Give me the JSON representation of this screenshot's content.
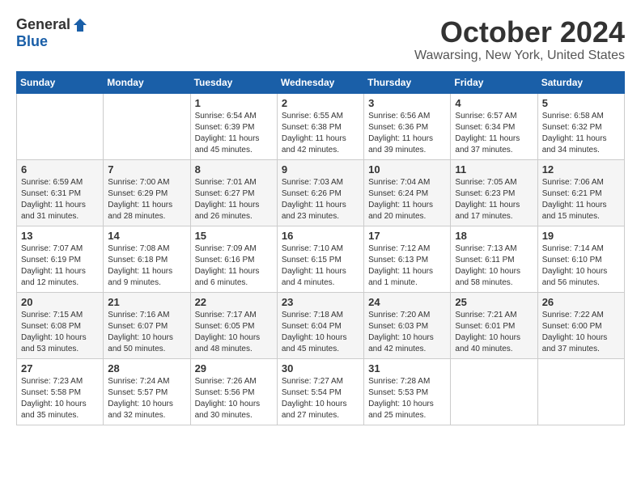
{
  "logo": {
    "general": "General",
    "blue": "Blue"
  },
  "title": "October 2024",
  "location": "Wawarsing, New York, United States",
  "days_of_week": [
    "Sunday",
    "Monday",
    "Tuesday",
    "Wednesday",
    "Thursday",
    "Friday",
    "Saturday"
  ],
  "weeks": [
    [
      {
        "day": "",
        "sunrise": "",
        "sunset": "",
        "daylight": ""
      },
      {
        "day": "",
        "sunrise": "",
        "sunset": "",
        "daylight": ""
      },
      {
        "day": "1",
        "sunrise": "Sunrise: 6:54 AM",
        "sunset": "Sunset: 6:39 PM",
        "daylight": "Daylight: 11 hours and 45 minutes."
      },
      {
        "day": "2",
        "sunrise": "Sunrise: 6:55 AM",
        "sunset": "Sunset: 6:38 PM",
        "daylight": "Daylight: 11 hours and 42 minutes."
      },
      {
        "day": "3",
        "sunrise": "Sunrise: 6:56 AM",
        "sunset": "Sunset: 6:36 PM",
        "daylight": "Daylight: 11 hours and 39 minutes."
      },
      {
        "day": "4",
        "sunrise": "Sunrise: 6:57 AM",
        "sunset": "Sunset: 6:34 PM",
        "daylight": "Daylight: 11 hours and 37 minutes."
      },
      {
        "day": "5",
        "sunrise": "Sunrise: 6:58 AM",
        "sunset": "Sunset: 6:32 PM",
        "daylight": "Daylight: 11 hours and 34 minutes."
      }
    ],
    [
      {
        "day": "6",
        "sunrise": "Sunrise: 6:59 AM",
        "sunset": "Sunset: 6:31 PM",
        "daylight": "Daylight: 11 hours and 31 minutes."
      },
      {
        "day": "7",
        "sunrise": "Sunrise: 7:00 AM",
        "sunset": "Sunset: 6:29 PM",
        "daylight": "Daylight: 11 hours and 28 minutes."
      },
      {
        "day": "8",
        "sunrise": "Sunrise: 7:01 AM",
        "sunset": "Sunset: 6:27 PM",
        "daylight": "Daylight: 11 hours and 26 minutes."
      },
      {
        "day": "9",
        "sunrise": "Sunrise: 7:03 AM",
        "sunset": "Sunset: 6:26 PM",
        "daylight": "Daylight: 11 hours and 23 minutes."
      },
      {
        "day": "10",
        "sunrise": "Sunrise: 7:04 AM",
        "sunset": "Sunset: 6:24 PM",
        "daylight": "Daylight: 11 hours and 20 minutes."
      },
      {
        "day": "11",
        "sunrise": "Sunrise: 7:05 AM",
        "sunset": "Sunset: 6:23 PM",
        "daylight": "Daylight: 11 hours and 17 minutes."
      },
      {
        "day": "12",
        "sunrise": "Sunrise: 7:06 AM",
        "sunset": "Sunset: 6:21 PM",
        "daylight": "Daylight: 11 hours and 15 minutes."
      }
    ],
    [
      {
        "day": "13",
        "sunrise": "Sunrise: 7:07 AM",
        "sunset": "Sunset: 6:19 PM",
        "daylight": "Daylight: 11 hours and 12 minutes."
      },
      {
        "day": "14",
        "sunrise": "Sunrise: 7:08 AM",
        "sunset": "Sunset: 6:18 PM",
        "daylight": "Daylight: 11 hours and 9 minutes."
      },
      {
        "day": "15",
        "sunrise": "Sunrise: 7:09 AM",
        "sunset": "Sunset: 6:16 PM",
        "daylight": "Daylight: 11 hours and 6 minutes."
      },
      {
        "day": "16",
        "sunrise": "Sunrise: 7:10 AM",
        "sunset": "Sunset: 6:15 PM",
        "daylight": "Daylight: 11 hours and 4 minutes."
      },
      {
        "day": "17",
        "sunrise": "Sunrise: 7:12 AM",
        "sunset": "Sunset: 6:13 PM",
        "daylight": "Daylight: 11 hours and 1 minute."
      },
      {
        "day": "18",
        "sunrise": "Sunrise: 7:13 AM",
        "sunset": "Sunset: 6:11 PM",
        "daylight": "Daylight: 10 hours and 58 minutes."
      },
      {
        "day": "19",
        "sunrise": "Sunrise: 7:14 AM",
        "sunset": "Sunset: 6:10 PM",
        "daylight": "Daylight: 10 hours and 56 minutes."
      }
    ],
    [
      {
        "day": "20",
        "sunrise": "Sunrise: 7:15 AM",
        "sunset": "Sunset: 6:08 PM",
        "daylight": "Daylight: 10 hours and 53 minutes."
      },
      {
        "day": "21",
        "sunrise": "Sunrise: 7:16 AM",
        "sunset": "Sunset: 6:07 PM",
        "daylight": "Daylight: 10 hours and 50 minutes."
      },
      {
        "day": "22",
        "sunrise": "Sunrise: 7:17 AM",
        "sunset": "Sunset: 6:05 PM",
        "daylight": "Daylight: 10 hours and 48 minutes."
      },
      {
        "day": "23",
        "sunrise": "Sunrise: 7:18 AM",
        "sunset": "Sunset: 6:04 PM",
        "daylight": "Daylight: 10 hours and 45 minutes."
      },
      {
        "day": "24",
        "sunrise": "Sunrise: 7:20 AM",
        "sunset": "Sunset: 6:03 PM",
        "daylight": "Daylight: 10 hours and 42 minutes."
      },
      {
        "day": "25",
        "sunrise": "Sunrise: 7:21 AM",
        "sunset": "Sunset: 6:01 PM",
        "daylight": "Daylight: 10 hours and 40 minutes."
      },
      {
        "day": "26",
        "sunrise": "Sunrise: 7:22 AM",
        "sunset": "Sunset: 6:00 PM",
        "daylight": "Daylight: 10 hours and 37 minutes."
      }
    ],
    [
      {
        "day": "27",
        "sunrise": "Sunrise: 7:23 AM",
        "sunset": "Sunset: 5:58 PM",
        "daylight": "Daylight: 10 hours and 35 minutes."
      },
      {
        "day": "28",
        "sunrise": "Sunrise: 7:24 AM",
        "sunset": "Sunset: 5:57 PM",
        "daylight": "Daylight: 10 hours and 32 minutes."
      },
      {
        "day": "29",
        "sunrise": "Sunrise: 7:26 AM",
        "sunset": "Sunset: 5:56 PM",
        "daylight": "Daylight: 10 hours and 30 minutes."
      },
      {
        "day": "30",
        "sunrise": "Sunrise: 7:27 AM",
        "sunset": "Sunset: 5:54 PM",
        "daylight": "Daylight: 10 hours and 27 minutes."
      },
      {
        "day": "31",
        "sunrise": "Sunrise: 7:28 AM",
        "sunset": "Sunset: 5:53 PM",
        "daylight": "Daylight: 10 hours and 25 minutes."
      },
      {
        "day": "",
        "sunrise": "",
        "sunset": "",
        "daylight": ""
      },
      {
        "day": "",
        "sunrise": "",
        "sunset": "",
        "daylight": ""
      }
    ]
  ]
}
